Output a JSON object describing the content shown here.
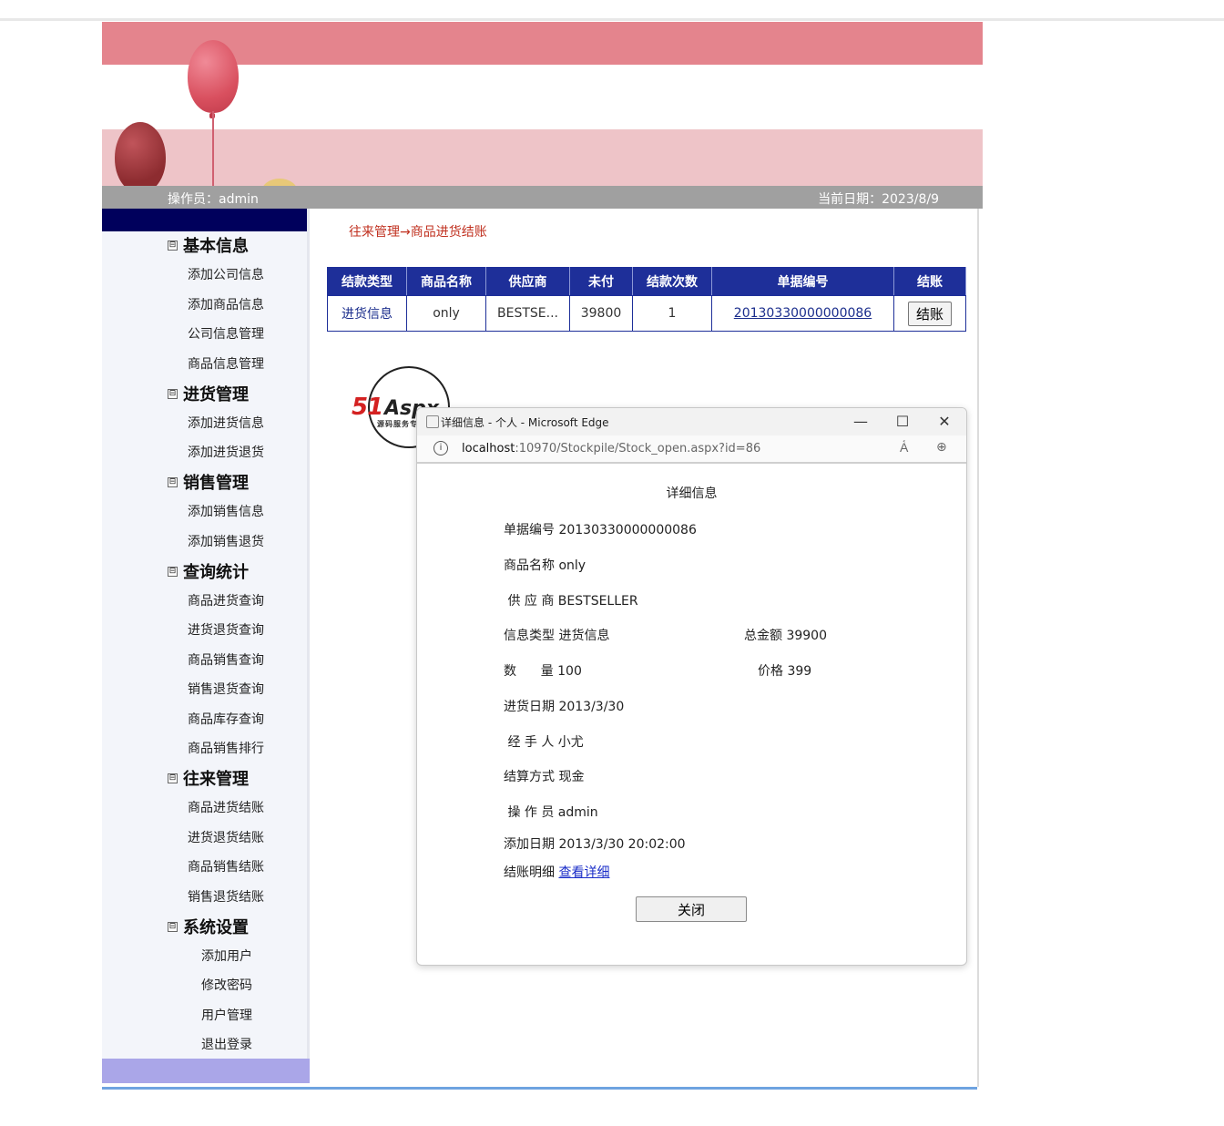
{
  "header": {
    "operator_label": "操作员：admin",
    "date_label": "当前日期：2023/8/9"
  },
  "sidebar": {
    "groups": [
      {
        "title": "基本信息",
        "items": [
          "添加公司信息",
          "添加商品信息",
          "公司信息管理",
          "商品信息管理"
        ]
      },
      {
        "title": "进货管理",
        "items": [
          "添加进货信息",
          "添加进货退货"
        ]
      },
      {
        "title": "销售管理",
        "items": [
          "添加销售信息",
          "添加销售退货"
        ]
      },
      {
        "title": "查询统计",
        "items": [
          "商品进货查询",
          "进货退货查询",
          "商品销售查询",
          "销售退货查询",
          "商品库存查询",
          "商品销售排行"
        ]
      },
      {
        "title": "往来管理",
        "items": [
          "商品进货结账",
          "进货退货结账",
          "商品销售结账",
          "销售退货结账"
        ]
      },
      {
        "title": "系统设置",
        "items": [
          "添加用户",
          "修改密码",
          "用户管理",
          "退出登录"
        ]
      }
    ],
    "collapse_glyph": "⊟"
  },
  "main": {
    "breadcrumb": "往来管理→商品进货结账",
    "table": {
      "headers": [
        "结款类型",
        "商品名称",
        "供应商",
        "未付",
        "结款次数",
        "单据编号",
        "结账"
      ],
      "rows": [
        {
          "type": "进货信息",
          "name": "only",
          "supplier": "BESTSE...",
          "unpaid": "39800",
          "count": "1",
          "doc_no": "20130330000000086",
          "action": "结账"
        }
      ]
    }
  },
  "logo": {
    "text_51": "51",
    "text_aspx": "Aspx",
    "subtitle": "源码服务专家"
  },
  "popup": {
    "window_title": "详细信息 - 个人 - Microsoft Edge",
    "url_host": "localhost",
    "url_rest": ":10970/Stockpile/Stock_open.aspx?id=86",
    "controls": {
      "minimize": "—",
      "maximize": "☐",
      "close": "✕"
    },
    "heading": "详细信息",
    "doc_no": "单据编号 20130330000000086",
    "product": "商品名称 only",
    "supplier": " 供 应 商 BESTSELLER",
    "info_type": "信息类型 进货信息",
    "total": "总金额 39900",
    "quantity": "数      量 100",
    "price": "价格 399",
    "stock_date": "进货日期 2013/3/30",
    "handler": " 经 手 人 小尤",
    "settlement": "结算方式 现金",
    "operator": " 操 作 员 admin",
    "added_date": "添加日期 2013/3/30 20:02:00",
    "detail_label": "结账明细",
    "detail_link": "查看详细",
    "close_button": "关闭"
  }
}
